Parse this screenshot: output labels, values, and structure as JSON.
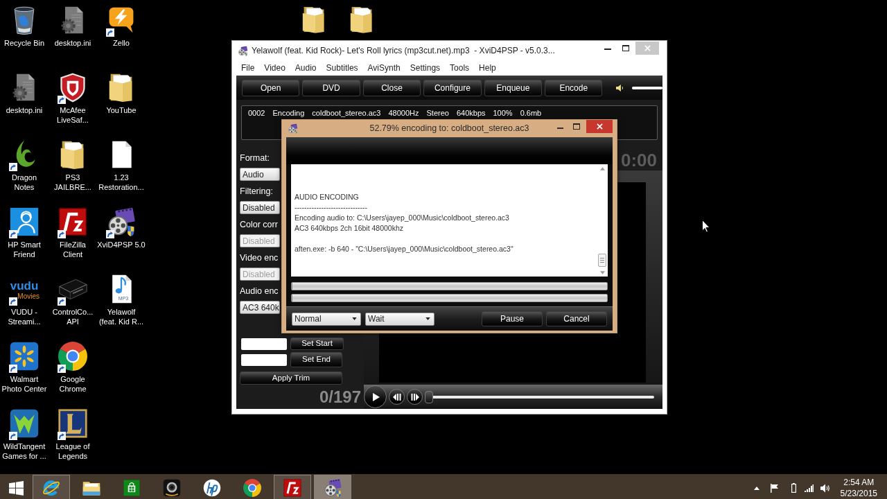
{
  "desktop_icons": [
    {
      "kind": "recycle-bin",
      "label": [
        "Recycle Bin"
      ],
      "shortcut": false
    },
    {
      "kind": "settings-file",
      "label": [
        "desktop.ini"
      ],
      "shortcut": false
    },
    {
      "kind": "dragon",
      "label": [
        "Dragon",
        "Notes"
      ],
      "shortcut": true
    },
    {
      "kind": "hp-support",
      "label": [
        "HP Smart",
        "Friend"
      ],
      "shortcut": true
    },
    {
      "kind": "vudu",
      "logo": [
        "vudu",
        "Movies"
      ],
      "label": [
        "VUDU -",
        "Streami..."
      ],
      "shortcut": true
    },
    {
      "kind": "walmart",
      "label": [
        "Walmart",
        "Photo Center"
      ],
      "shortcut": true
    },
    {
      "kind": "wildtangent",
      "label": [
        "WildTangent",
        "Games for ..."
      ],
      "shortcut": true
    },
    {
      "kind": "settings-file",
      "label": [
        "desktop.ini"
      ],
      "shortcut": false
    },
    {
      "kind": "mcafee",
      "label": [
        "McAfee",
        "LiveSaf..."
      ],
      "shortcut": true
    },
    {
      "kind": "folder",
      "label": [
        "PS3",
        "JAILBRE..."
      ],
      "shortcut": false
    },
    {
      "kind": "filezilla",
      "label": [
        "FileZilla",
        "Client"
      ],
      "shortcut": true
    },
    {
      "kind": "console",
      "label": [
        "ControlCo...",
        "API"
      ],
      "shortcut": true
    },
    {
      "kind": "chrome",
      "label": [
        "Google",
        "Chrome"
      ],
      "shortcut": true
    },
    {
      "kind": "league",
      "label": [
        "League of",
        "Legends"
      ],
      "shortcut": true
    },
    {
      "kind": "zello",
      "label": [
        "Zello"
      ],
      "shortcut": true
    },
    {
      "kind": "folder",
      "label": [
        "YouTube"
      ],
      "shortcut": false
    },
    {
      "kind": "document",
      "label": [
        "1.23",
        "Restoration..."
      ],
      "shortcut": false
    },
    {
      "kind": "xvid",
      "label": [
        "XviD4PSP 5.0"
      ],
      "shortcut": true
    },
    {
      "kind": "audio-file",
      "badge": "MP3",
      "label": [
        "Yelawolf",
        "(feat. Kid R..."
      ],
      "shortcut": false
    }
  ],
  "main_window": {
    "title": "Yelawolf (feat. Kid Rock)- Let's Roll lyrics (mp3cut.net).mp3  - XviD4PSP - v5.0.3...",
    "menu": [
      "File",
      "Video",
      "Audio",
      "Subtitles",
      "AviSynth",
      "Settings",
      "Tools",
      "Help"
    ],
    "toolbar": [
      "Open",
      "DVD",
      "Close",
      "Configure",
      "Enqueue",
      "Encode"
    ],
    "volume": {
      "level": 1
    },
    "queue": [
      [
        "0002",
        "Encoding",
        "coldboot_stereo.ac3",
        "48000Hz",
        "Stereo",
        "640kbps",
        "100%",
        "0.6mb"
      ]
    ],
    "settings": [
      {
        "label": "Format:",
        "value": "Audio",
        "disabled": false
      },
      {
        "label": "Filtering:",
        "value": "Disabled",
        "disabled": false
      },
      {
        "label": "Color corr",
        "value": "Disabled",
        "disabled": true
      },
      {
        "label": "Video enc",
        "value": "Disabled",
        "disabled": true
      },
      {
        "label": "Audio enc",
        "value": "AC3 640k",
        "disabled": false
      }
    ],
    "trim": {
      "set_start": "Set Start",
      "set_end": "Set End",
      "apply": "Apply Trim"
    },
    "clock": "0:00",
    "frame_counter": "0/197",
    "seek": {
      "level": 0
    }
  },
  "encoding_dialog": {
    "title": "52.79% encoding to: coldboot_stereo.ac3",
    "log": [
      [
        "AUDIO ENCODING",
        "------------------------------",
        "Encoding audio to: C:\\Users\\jayep_000\\Music\\coldboot_stereo.ac3",
        "AC3 640kbps 2ch 16bit 48000khz"
      ],
      [
        "aften.exe: -b 640 - \"C:\\Users\\jayep_000\\Music\\coldboot_stereo.ac3\""
      ]
    ],
    "progress": [
      {
        "level": 0
      },
      {
        "level": 0
      }
    ],
    "dropdowns": [
      {
        "value": "Normal"
      },
      {
        "value": "Wait"
      }
    ],
    "buttons": [
      "Pause",
      "Cancel"
    ]
  },
  "taskbar": {
    "apps": [
      {
        "kind": "ie",
        "running": true,
        "selected": false
      },
      {
        "kind": "explorer",
        "running": false,
        "selected": false
      },
      {
        "kind": "store",
        "running": false,
        "selected": false
      },
      {
        "kind": "camera",
        "running": false,
        "selected": false
      },
      {
        "kind": "hp",
        "running": false,
        "selected": false
      },
      {
        "kind": "chrome",
        "running": false,
        "selected": false
      },
      {
        "kind": "filezilla",
        "running": true,
        "selected": false
      },
      {
        "kind": "xvid",
        "running": true,
        "selected": true
      }
    ],
    "time": "2:54 AM",
    "date": "5/23/2015"
  }
}
